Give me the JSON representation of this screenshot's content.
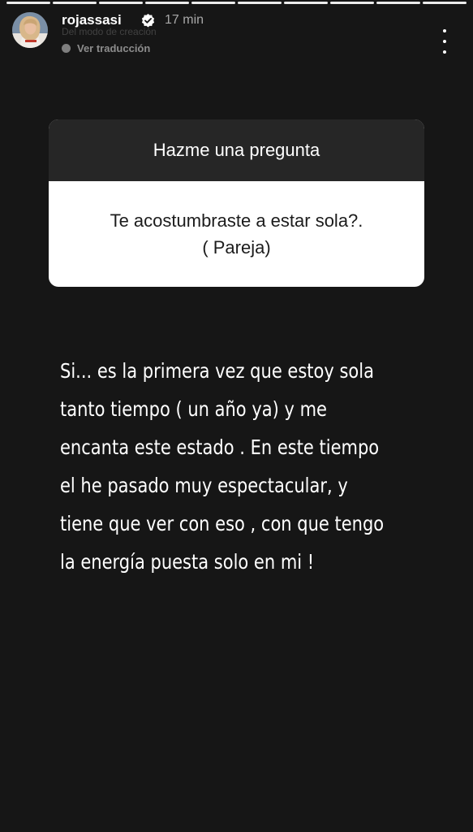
{
  "story": {
    "progress": {
      "segments": 10,
      "completed": 10
    }
  },
  "header": {
    "username": "rojassasi",
    "verified_icon": "verified-badge-icon",
    "time": "17 min",
    "faded_line": "Del modo de creación",
    "translate_label": "Ver traducción",
    "menu_icon": "more-vertical-icon"
  },
  "question_card": {
    "title": "Hazme una pregunta",
    "question_lines": [
      "Te acostumbraste a estar sola?.",
      "( Pareja)"
    ]
  },
  "answer": {
    "lines": [
      "Si... es la primera vez que estoy sola",
      "tanto tiempo ( un año ya) y me",
      "encanta este estado . En este tiempo",
      "el he pasado muy espectacular, y",
      "tiene que ver con eso , con que tengo",
      "la energía puesta solo en mi !"
    ]
  },
  "colors": {
    "background": "#161616",
    "card_header": "#262626",
    "card_body": "#ffffff"
  }
}
